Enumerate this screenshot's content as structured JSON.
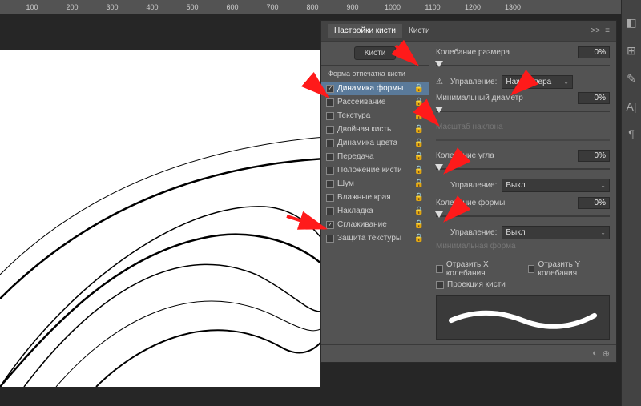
{
  "ruler_marks": [
    "100",
    "200",
    "300",
    "400",
    "500",
    "600",
    "700",
    "800",
    "900",
    "1000",
    "1100",
    "1200",
    "1300"
  ],
  "panel": {
    "tabs": [
      "Настройки кисти",
      "Кисти"
    ],
    "brush_button": "Кисти",
    "section_title": "Форма отпечатка кисти",
    "options": [
      {
        "label": "Динамика формы",
        "checked": true,
        "lock": true,
        "selected": true
      },
      {
        "label": "Рассеивание",
        "checked": false,
        "lock": true
      },
      {
        "label": "Текстура",
        "checked": false,
        "lock": true
      },
      {
        "label": "Двойная кисть",
        "checked": false,
        "lock": true
      },
      {
        "label": "Динамика цвета",
        "checked": false,
        "lock": true
      },
      {
        "label": "Передача",
        "checked": false,
        "lock": true
      },
      {
        "label": "Положение кисти",
        "checked": false,
        "lock": true
      },
      {
        "label": "Шум",
        "checked": false,
        "lock": true
      },
      {
        "label": "Влажные края",
        "checked": false,
        "lock": true
      },
      {
        "label": "Накладка",
        "checked": false,
        "lock": true
      },
      {
        "label": "Сглаживание",
        "checked": true,
        "lock": true
      },
      {
        "label": "Защита текстуры",
        "checked": false,
        "lock": true
      }
    ],
    "right": {
      "size_jitter": {
        "label": "Колебание размера",
        "value": "0%"
      },
      "control1": {
        "label": "Управление:",
        "value": "Нажим пера"
      },
      "min_diameter": {
        "label": "Минимальный диаметр",
        "value": "0%"
      },
      "tilt_scale": {
        "label": "Масштаб наклона"
      },
      "angle_jitter": {
        "label": "Колебание угла",
        "value": "0%"
      },
      "control2": {
        "label": "Управление:",
        "value": "Выкл"
      },
      "roundness_jitter": {
        "label": "Колебание формы",
        "value": "0%"
      },
      "control3": {
        "label": "Управление:",
        "value": "Выкл"
      },
      "min_roundness": {
        "label": "Минимальная форма"
      },
      "flip_x": "Отразить X колебания",
      "flip_y": "Отразить Y колебания",
      "brush_projection": "Проекция кисти"
    }
  }
}
